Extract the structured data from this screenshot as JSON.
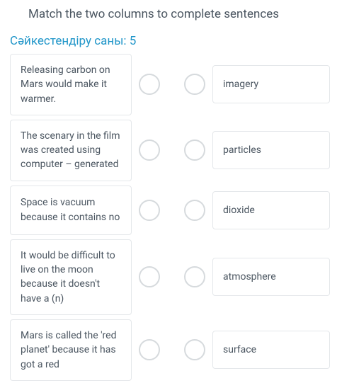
{
  "header": {
    "title": "Match the two columns to complete sentences"
  },
  "match_label": "Сәйкестендіру саны: 5",
  "rows": [
    {
      "left": "Releasing carbon on Mars would make it warmer.",
      "right": "imagery"
    },
    {
      "left": "The scenary in the film was created using computer – generated",
      "right": "particles"
    },
    {
      "left": "Space is vacuum because it contains no",
      "right": "dioxide"
    },
    {
      "left": "It would be difficult to live on the moon because it doesn't have a (n)",
      "right": "atmosphere"
    },
    {
      "left": "Mars is called the 'red planet' because it has got a red",
      "right": "surface"
    }
  ]
}
